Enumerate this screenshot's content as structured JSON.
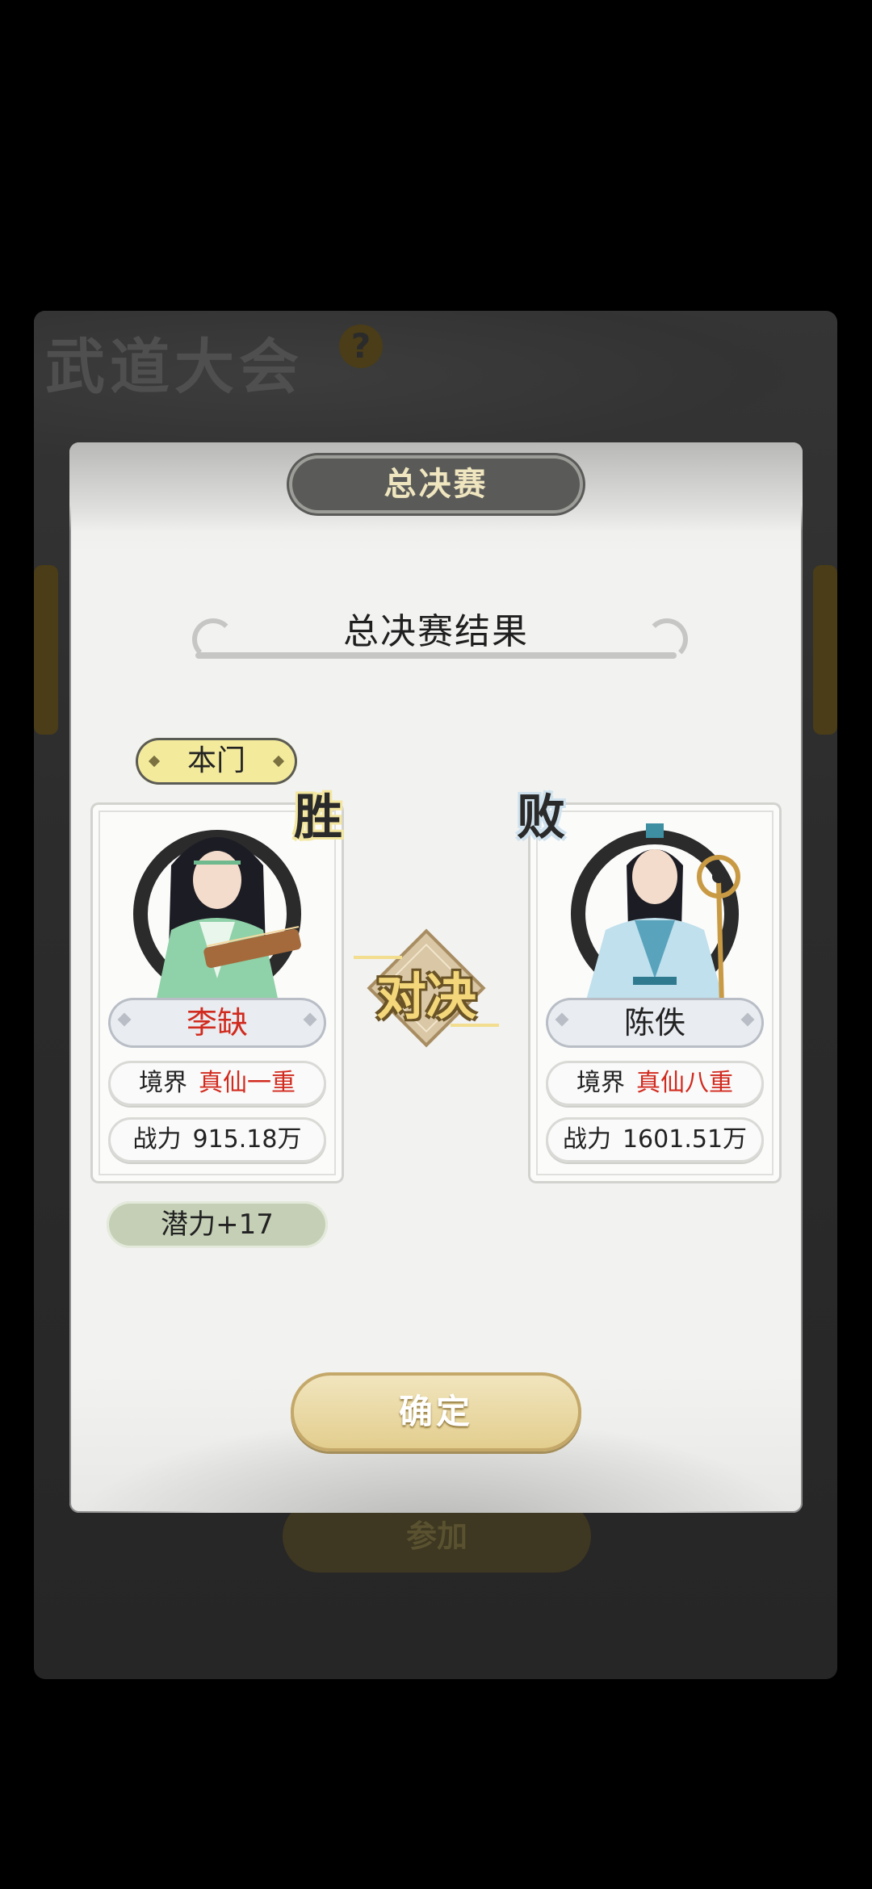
{
  "background": {
    "title": "武道大会",
    "help_icon": "question-mark",
    "join_label": "参加"
  },
  "modal": {
    "header": "总决赛",
    "subtitle": "总决赛结果",
    "vs_label": "对决",
    "confirm_label": "确定"
  },
  "left_player": {
    "tag": "本门",
    "result": "胜",
    "name": "李缺",
    "realm_label": "境界",
    "realm_value": "真仙一重",
    "power_label": "战力",
    "power_value": "915.18万",
    "potential": "潜力+17"
  },
  "right_player": {
    "result": "败",
    "name": "陈佚",
    "realm_label": "境界",
    "realm_value": "真仙八重",
    "power_label": "战力",
    "power_value": "1601.51万"
  },
  "colors": {
    "accent_gold": "#e2cd8c",
    "red_text": "#d12a1e",
    "potential_green": "#c4cfb6"
  }
}
